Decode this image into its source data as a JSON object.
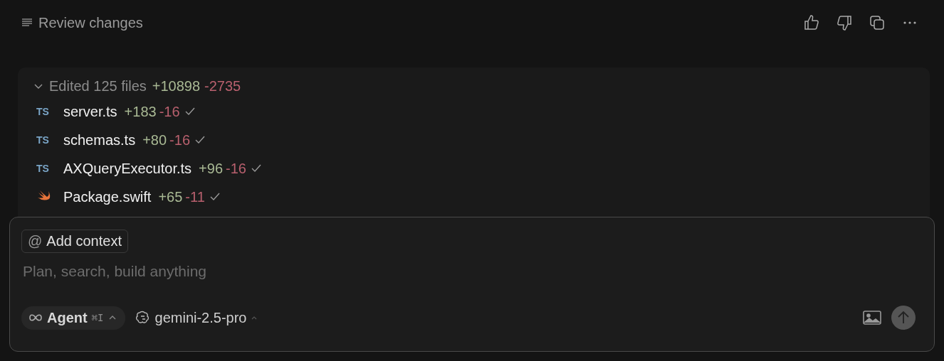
{
  "header": {
    "title": "Review changes"
  },
  "changes": {
    "expanded": true,
    "summary": "Edited 125 files",
    "added": "+10898",
    "removed": "-2735",
    "files": [
      {
        "kind": "ts",
        "badge": "TS",
        "name": "server.ts",
        "added": "+183",
        "removed": "-16",
        "accepted": true
      },
      {
        "kind": "ts",
        "badge": "TS",
        "name": "schemas.ts",
        "added": "+80",
        "removed": "-16",
        "accepted": true
      },
      {
        "kind": "ts",
        "badge": "TS",
        "name": "AXQueryExecutor.ts",
        "added": "+96",
        "removed": "-16",
        "accepted": true
      },
      {
        "kind": "swift",
        "name": "Package.swift",
        "added": "+65",
        "removed": "-11",
        "accepted": true
      }
    ]
  },
  "composer": {
    "context_mark": "@",
    "context_button": "Add context",
    "placeholder": "Plan, search, build anything",
    "mode": "Agent",
    "mode_shortcut": "⌘I",
    "model": "gemini-2.5-pro"
  }
}
